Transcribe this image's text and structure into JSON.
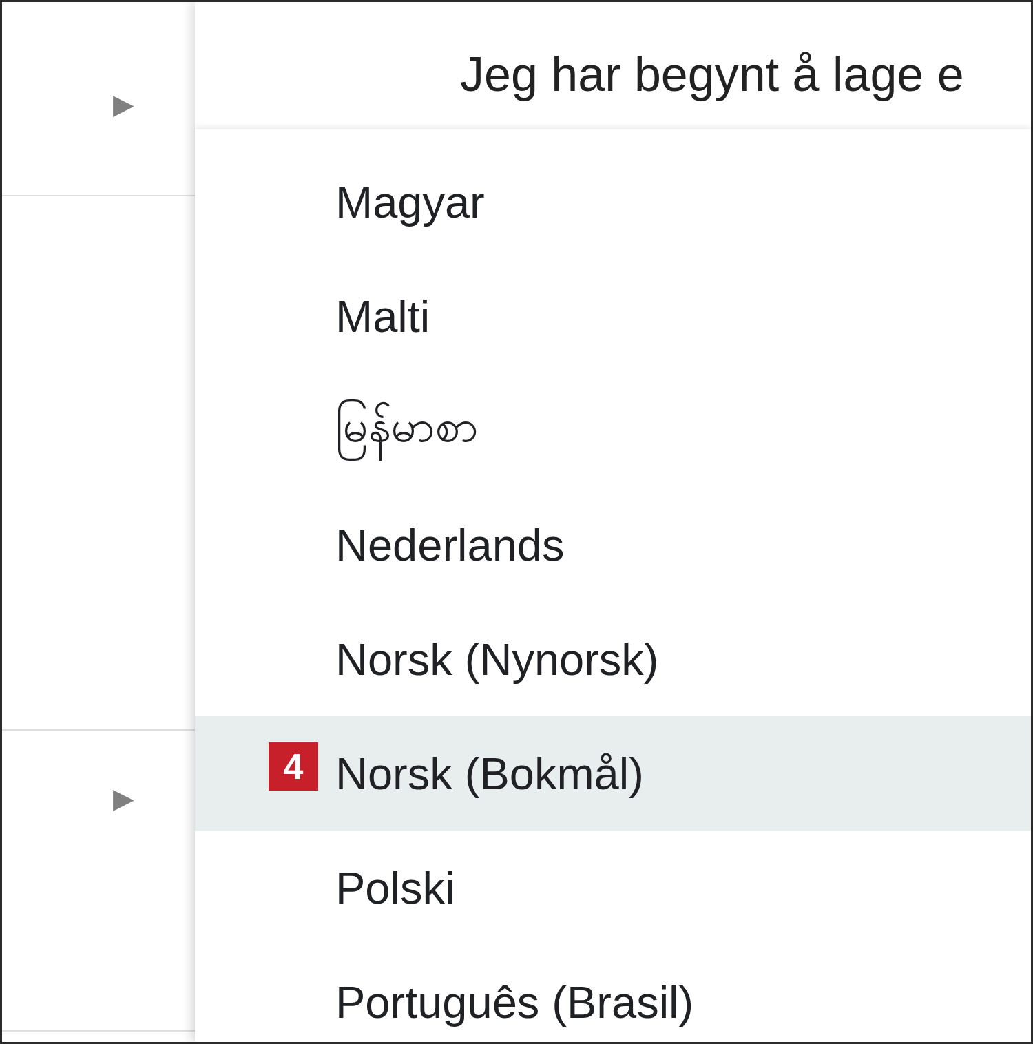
{
  "sidebar": {
    "rows": [
      {
        "kind": "expandable",
        "arrow": "▶"
      },
      {
        "kind": "blank"
      },
      {
        "kind": "expandable",
        "arrow": "▶"
      },
      {
        "kind": "blank"
      }
    ]
  },
  "document": {
    "text": "Jeg har begynt å lage e"
  },
  "language_menu": {
    "items": [
      {
        "label": "Magyar",
        "selected": false
      },
      {
        "label": "Malti",
        "selected": false
      },
      {
        "label": "မြန်မာစာ",
        "selected": false
      },
      {
        "label": "Nederlands",
        "selected": false
      },
      {
        "label": "Norsk (Nynorsk)",
        "selected": false
      },
      {
        "label": "Norsk (Bokmål)",
        "selected": true,
        "badge": "4"
      },
      {
        "label": "Polski",
        "selected": false
      },
      {
        "label": "Português (Brasil)",
        "selected": false
      }
    ]
  }
}
